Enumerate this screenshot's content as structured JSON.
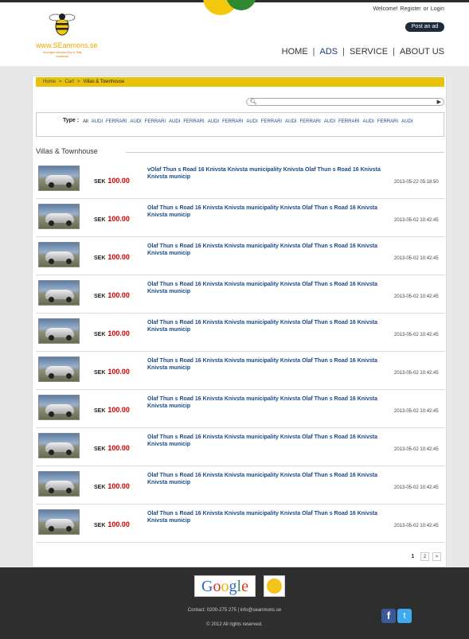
{
  "header": {
    "logo_text": "www.SEanmons.se",
    "logo_tagline": "Sveriges största Köp & Sälj marknad",
    "top_links": [
      "Welcome!",
      "Register",
      "or",
      "Login"
    ],
    "post_ad_label": "Post an ad",
    "nav": [
      "HOME",
      "ADS",
      "SERVICE",
      "ABOUT US"
    ],
    "nav_separator": "|",
    "active_nav": "ADS",
    "accent_yellow": "#f2c80f",
    "accent_green": "#2f8a2f"
  },
  "breadcrumb": {
    "items": [
      "Home",
      "Cart",
      "Villas & Townhouse"
    ],
    "separator": ">"
  },
  "search": {
    "icon": "search-icon",
    "go_icon": "play-arrow-icon"
  },
  "type_filter": {
    "label": "Type :",
    "items": [
      "All",
      "AUDI",
      "FERRARI",
      "AUDI",
      "FERRARI",
      "AUDI",
      "FERRARI",
      "AUDI",
      "FERRARI",
      "AUDI",
      "FERRARI",
      "AUDI",
      "FERRARI",
      "AUDI",
      "FERRARI",
      "AUDI",
      "FERRARI",
      "AUDI"
    ]
  },
  "section": {
    "title": "Villas & Townhouse"
  },
  "listings": [
    {
      "currency": "SEK",
      "price": "100.00",
      "title": "vOlaf Thun s Road 16 Knivsta Knivsta municipality Knivsta Olaf Thun s Road 16 Knivsta Knivsta municip",
      "date": "2013-05-22 05:18:50"
    },
    {
      "currency": "SEK",
      "price": "100.00",
      "title": "Olaf Thun s Road 16 Knivsta Knivsta municipality Knivsta Olaf Thun s Road 16 Knivsta Knivsta municip",
      "date": "2013-05-02 10:42:45"
    },
    {
      "currency": "SEK",
      "price": "100.00",
      "title": "Olaf Thun s Road 16 Knivsta Knivsta municipality Knivsta Olaf Thun s Road 16 Knivsta Knivsta municip",
      "date": "2013-05-02 10:42:45"
    },
    {
      "currency": "SEK",
      "price": "100.00",
      "title": "Olaf Thun s Road 16 Knivsta Knivsta municipality Knivsta Olaf Thun s Road 16 Knivsta Knivsta municip",
      "date": "2013-05-02 10:42:45"
    },
    {
      "currency": "SEK",
      "price": "100.00",
      "title": "Olaf Thun s Road 16 Knivsta Knivsta municipality Knivsta Olaf Thun s Road 16 Knivsta Knivsta municip",
      "date": "2013-05-02 10:42:45"
    },
    {
      "currency": "SEK",
      "price": "100.00",
      "title": "Olaf Thun s Road 16 Knivsta Knivsta municipality Knivsta Olaf Thun s Road 16 Knivsta Knivsta municip",
      "date": "2013-05-02 10:42:45"
    },
    {
      "currency": "SEK",
      "price": "100.00",
      "title": "Olaf Thun s Road 16 Knivsta Knivsta municipality Knivsta Olaf Thun s Road 16 Knivsta Knivsta municip",
      "date": "2013-05-02 10:42:45"
    },
    {
      "currency": "SEK",
      "price": "100.00",
      "title": "Olaf Thun s Road 16 Knivsta Knivsta municipality Knivsta Olaf Thun s Road 16 Knivsta Knivsta municip",
      "date": "2013-05-02 10:42:45"
    },
    {
      "currency": "SEK",
      "price": "100.00",
      "title": "Olaf Thun s Road 16 Knivsta Knivsta municipality Knivsta Olaf Thun s Road 16 Knivsta Knivsta municip",
      "date": "2013-05-02 10:42:45"
    },
    {
      "currency": "SEK",
      "price": "100.00",
      "title": "Olaf Thun s Road 16 Knivsta Knivsta municipality Knivsta Olaf Thun s Road 16 Knivsta Knivsta municip",
      "date": "2013-05-02 10:42:45"
    }
  ],
  "pagination": {
    "current": "1",
    "pages": [
      "2"
    ],
    "next_label": ">"
  },
  "footer": {
    "google_letters": [
      "G",
      "o",
      "o",
      "g",
      "l",
      "e"
    ],
    "paypal_label": "PayPal verified",
    "contact": "Contact: 0200-275 275 | info@seanmons.se",
    "copyright": "© 2012 All rights reserved.",
    "facebook_label": "f",
    "twitter_label": "t"
  },
  "colors": {
    "breadcrumb_bg": "#e8c20a",
    "price": "#d00000",
    "link": "#1a4a8c",
    "footer_bg": "#2e2e2e"
  }
}
